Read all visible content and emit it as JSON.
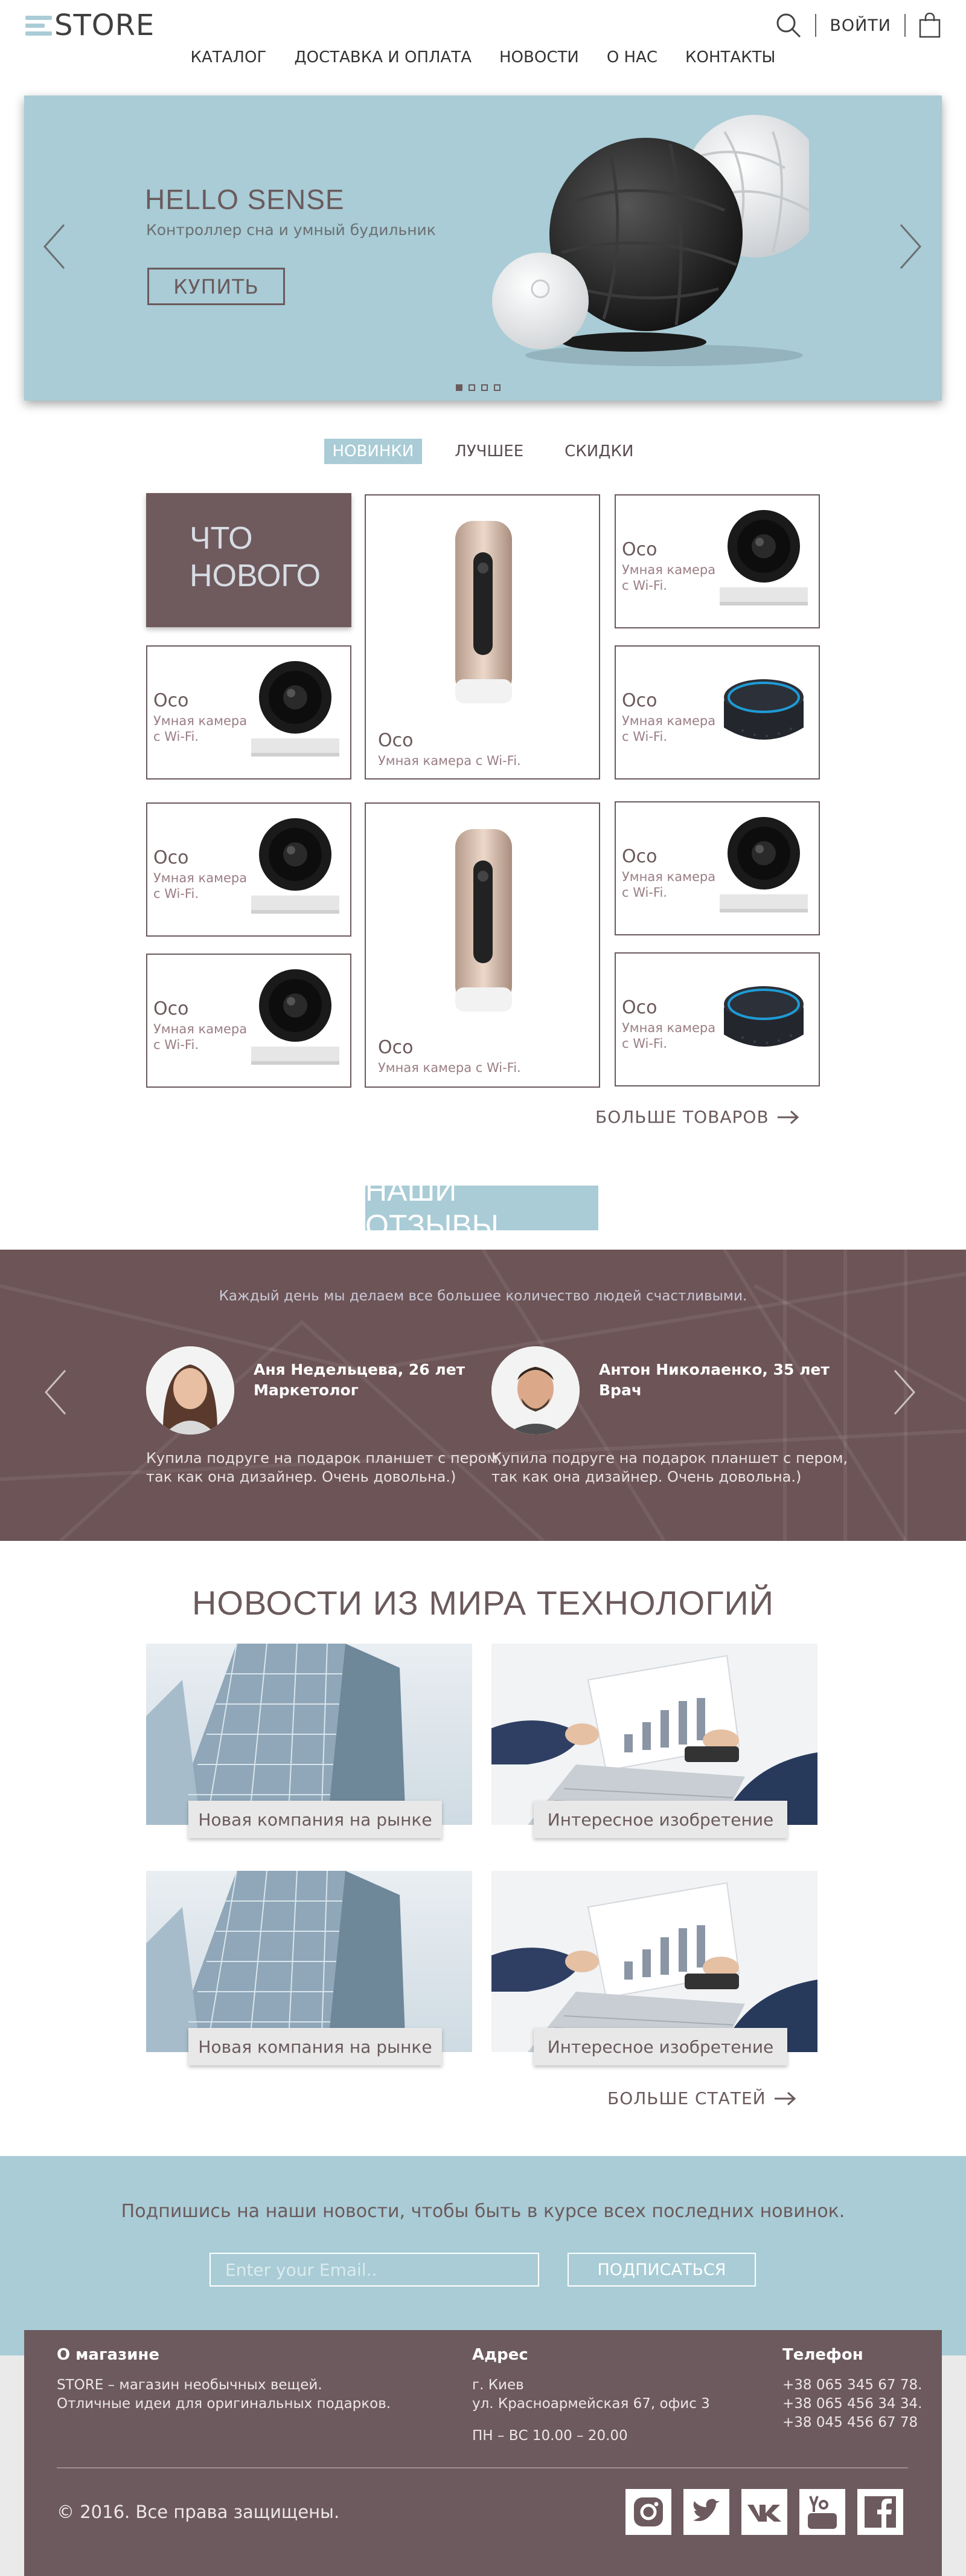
{
  "header": {
    "logo": "STORE",
    "login_label": "ВОЙТИ",
    "nav": [
      "КАТАЛОГ",
      "ДОСТАВКА И ОПЛАТА",
      "НОВОСТИ",
      "О НАС",
      "КОНТАКТЫ"
    ]
  },
  "hero": {
    "title": "HELLO SENSE",
    "subtitle": "Контроллер сна и умный будильник",
    "button": "КУПИТЬ",
    "slides": 4,
    "active_slide": 1
  },
  "tabs": [
    "НОВИНКИ",
    "ЛУЧШЕЕ",
    "СКИДКИ"
  ],
  "whats_new": {
    "line1": "ЧТО",
    "line2": "НОВОГО"
  },
  "products": [
    {
      "name": "Oco",
      "desc1": "Умная камера",
      "desc2": "с Wi-Fi.",
      "desc": "Умная камера с Wi-Fi.",
      "kind": "camera-icon"
    },
    {
      "name": "Oco",
      "desc1": "Умная камера",
      "desc2": "с Wi-Fi.",
      "desc": "Умная камера с Wi-Fi.",
      "kind": "speaker-icon"
    }
  ],
  "more_products": "БОЛЬШЕ ТОВАРОВ",
  "reviews": {
    "title": "НАШИ ОТЗЫВЫ",
    "tagline": "Каждый день мы делаем все большее количество людей счастливыми.",
    "items": [
      {
        "name": "Аня Недельцева, 26 лет",
        "role": "Маркетолог",
        "text1": "Купила подруге на подарок планшет с пером,",
        "text2": "так как она дизайнер. Очень довольна.)"
      },
      {
        "name": "Антон Николаенко, 35 лет",
        "role": "Врач",
        "text1": "Купила подруге на подарок планшет с пером,",
        "text2": "так как она дизайнер. Очень довольна.)"
      }
    ]
  },
  "news": {
    "title": "НОВОСТИ ИЗ МИРА ТЕХНОЛОГИЙ",
    "items": [
      "Новая компания на рынке",
      "Интересное изобретение",
      "Новая компания на рынке",
      "Интересное изобретение"
    ],
    "more": "БОЛЬШЕ СТАТЕЙ"
  },
  "subscribe": {
    "text": "Подпишись на наши новости, чтобы быть в курсе всех последних новинок.",
    "placeholder": "Enter your Email..",
    "button": "ПОДПИСАТЬСЯ"
  },
  "footer": {
    "about_title": "О магазине",
    "about_1": "STORE – магазин необычных вещей.",
    "about_2": "Отличные идеи для оригинальных подарков.",
    "address_title": "Адрес",
    "address_1": "г. Киев",
    "address_2": "ул. Красноармейская 67, офис 3",
    "hours": "ПН – ВС  10.00 – 20.00",
    "phone_title": "Телефон",
    "phones": [
      "+38 065 345 67 78.",
      "+38 065 456 34 34.",
      "+38 045 456 67 78"
    ],
    "copyright": "© 2016. Все права защищены.",
    "social": [
      "instagram-icon",
      "twitter-icon",
      "vk-icon",
      "youtube-icon",
      "facebook-icon"
    ]
  },
  "colors": {
    "accent": "#a9ccd6",
    "brand": "#6d5a5e",
    "text": "#6b5a5c"
  }
}
